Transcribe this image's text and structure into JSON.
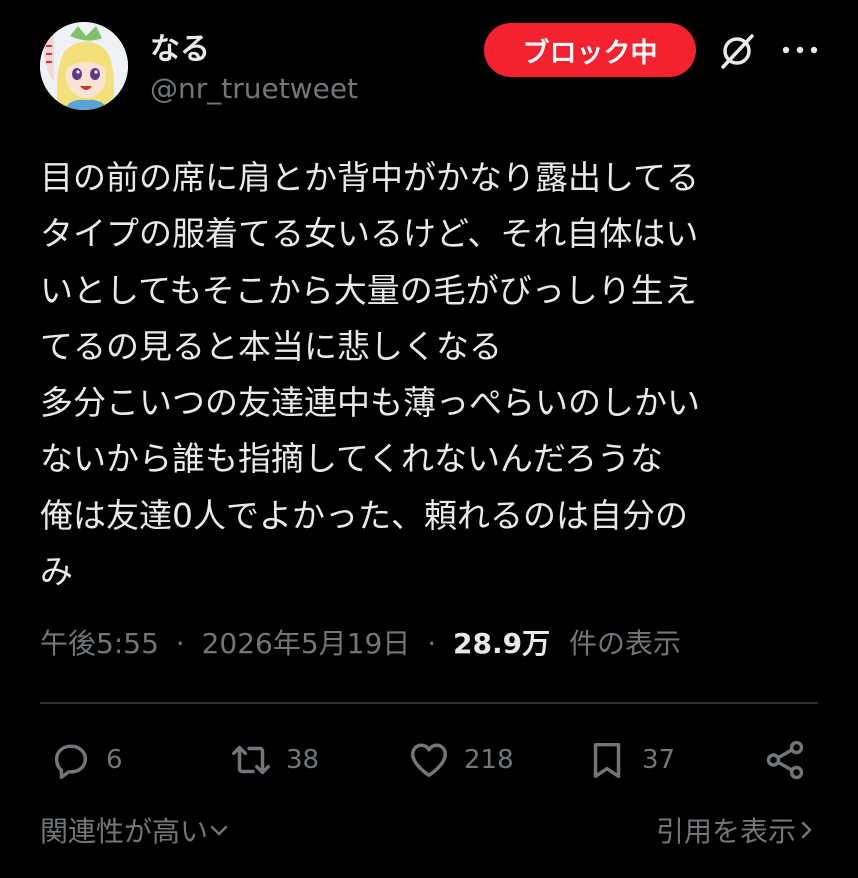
{
  "user": {
    "display_name": "なる",
    "handle": "@nr_truetweet"
  },
  "header": {
    "block_button_label": "ブロック中"
  },
  "tweet": {
    "lines": [
      "目の前の席に肩とか背中がかなり露出してる",
      "タイプの服着てる女いるけど、それ自体はい",
      "いとしてもそこから大量の毛がびっしり生え",
      "てるの見ると本当に悲しくなる",
      "多分こいつの友達連中も薄っぺらいのしかい",
      "ないから誰も指摘してくれないんだろうな",
      "俺は友達0人でよかった、頼れるのは自分の",
      "み"
    ]
  },
  "meta": {
    "time": "午後5:55",
    "separator": "·",
    "date": "2026年5月19日",
    "views_count": "28.9万",
    "views_label": "件の表示"
  },
  "actions": {
    "reply_count": "6",
    "retweet_count": "38",
    "like_count": "218",
    "bookmark_count": "37"
  },
  "footer": {
    "sort_label": "関連性が高い",
    "quote_label": "引用を表示"
  },
  "colors": {
    "background": "#000000",
    "text": "#e7e9ea",
    "secondary": "#71767b",
    "block_button": "#f4212e",
    "divider": "#2f3336"
  },
  "icons": [
    "grok-icon",
    "more-icon",
    "reply-icon",
    "retweet-icon",
    "like-icon",
    "bookmark-icon",
    "share-icon",
    "chevron-down-icon",
    "chevron-right-icon"
  ]
}
